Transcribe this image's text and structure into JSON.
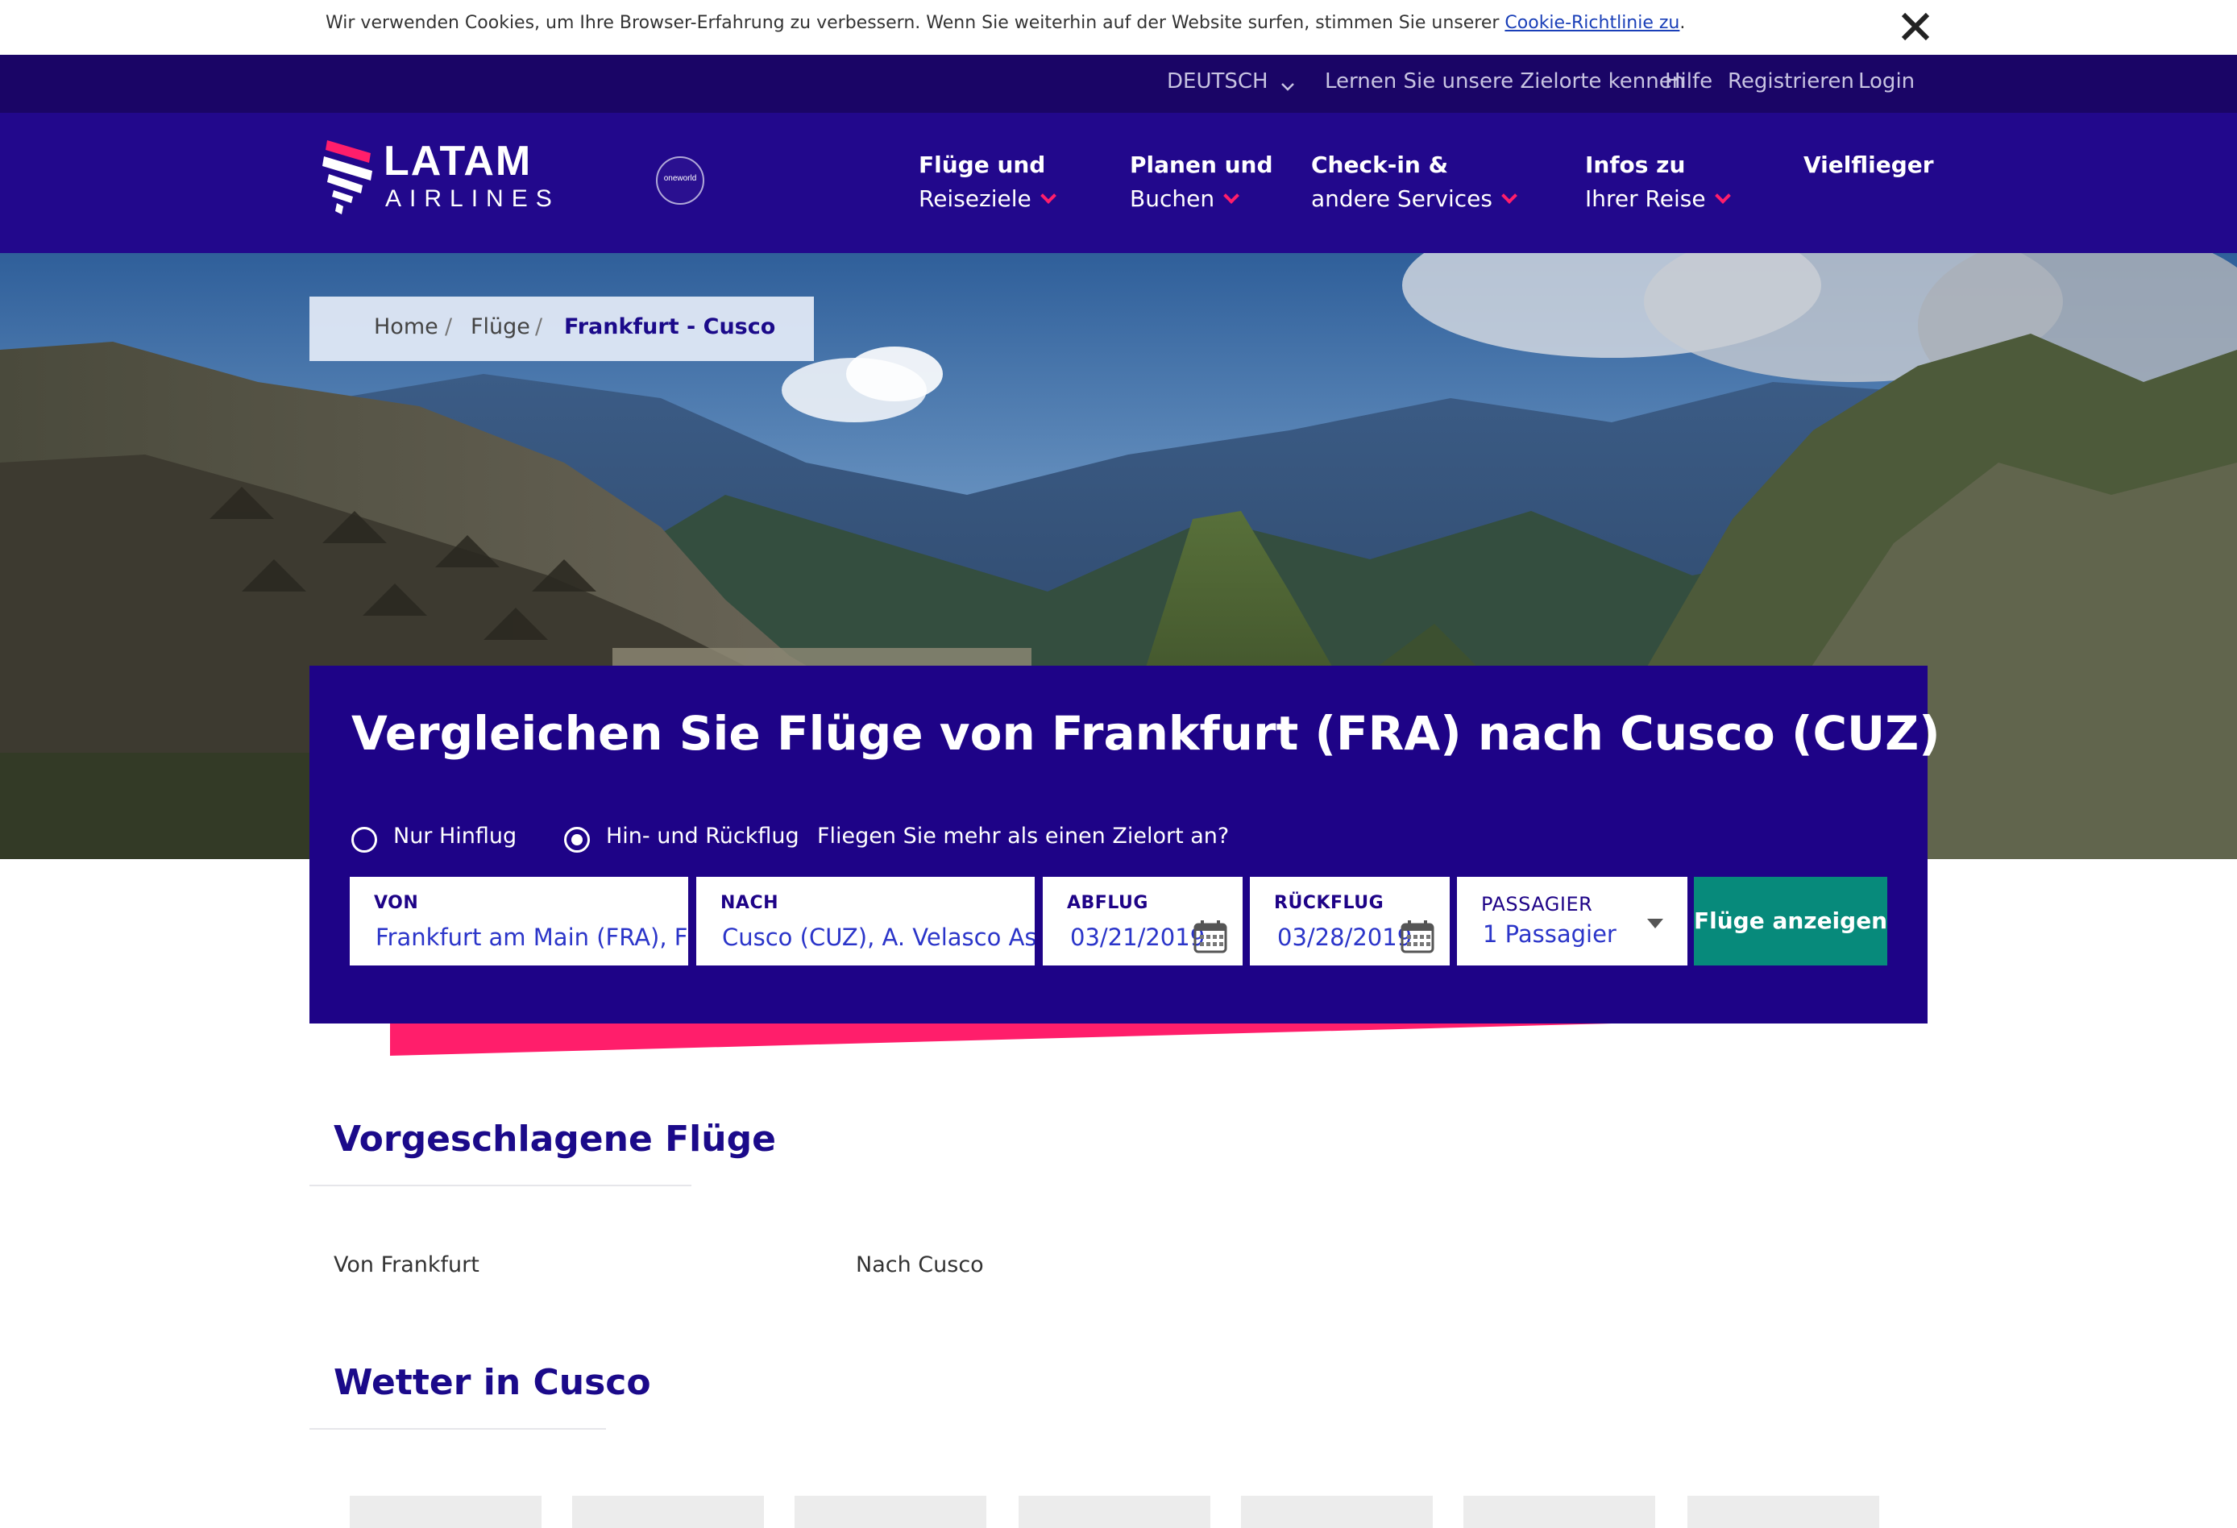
{
  "cookie": {
    "text": "Wir verwenden Cookies, um Ihre Browser-Erfahrung zu verbessern. Wenn Sie weiterhin auf der Website surfen, stimmen Sie unserer ",
    "link": "Cookie-Richtlinie zu",
    "suffix": "."
  },
  "top_bar": {
    "language": "DEUTSCH",
    "links": [
      "Lernen Sie unsere Zielorte kennen",
      "Hilfe",
      "Registrieren",
      "Login"
    ]
  },
  "header": {
    "logo_word": "LATAM",
    "logo_sub": "AIRLINES",
    "oneworld": "oneworld",
    "nav": [
      {
        "line1": "Flüge und",
        "line2": "Reiseziele"
      },
      {
        "line1": "Planen und",
        "line2": "Buchen"
      },
      {
        "line1": "Check-in &",
        "line2": "andere Services"
      },
      {
        "line1": "Infos zu",
        "line2": "Ihrer Reise"
      },
      {
        "line1": "Vielflieger",
        "line2": ""
      }
    ]
  },
  "breadcrumb": {
    "items": [
      "Home",
      "Flüge"
    ],
    "separator": "/",
    "current": "Frankfurt - Cusco"
  },
  "search": {
    "title": "Vergleichen Sie Flüge von Frankfurt (FRA) nach Cusco (CUZ)",
    "trip_types": [
      {
        "label": "Nur Hinflug",
        "selected": false
      },
      {
        "label": "Hin- und Rückflug",
        "selected": true
      }
    ],
    "multi_link": "Fliegen Sie mehr als einen Zielort an?",
    "fields": {
      "from": {
        "label": "VON",
        "value": "Frankfurt am Main (FRA), F"
      },
      "to": {
        "label": "NACH",
        "value": "Cusco (CUZ), A. Velasco As"
      },
      "depart": {
        "label": "ABFLUG",
        "value": "03/21/2019"
      },
      "return": {
        "label": "RÜCKFLUG",
        "value": "03/28/2019"
      },
      "passengers": {
        "label": "PASSAGIER",
        "value": "1 Passagier"
      }
    },
    "button": "Flüge anzeigen"
  },
  "suggested": {
    "title": "Vorgeschlagene Flüge",
    "from_label": "Von Frankfurt",
    "to_label": "Nach Cusco"
  },
  "weather": {
    "title": "Wetter in Cusco",
    "card_count": 7
  },
  "colors": {
    "top_bar": "#1a0566",
    "header": "#22088c",
    "panel": "#1e0387",
    "accent_pink": "#ff1e6b",
    "button_teal": "#078a7b"
  }
}
